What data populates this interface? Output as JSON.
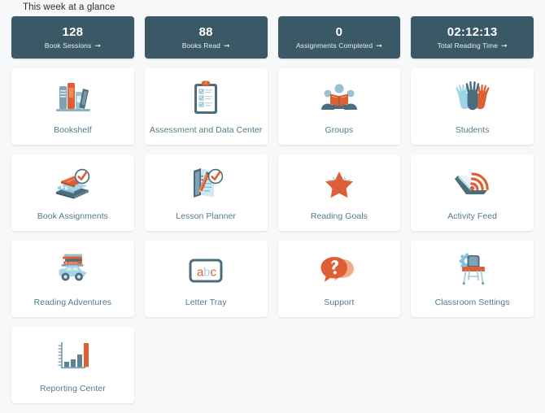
{
  "header": {
    "title": "This week at a glance"
  },
  "colors": {
    "page_background": "#f7f8f9",
    "stat_card_background": "#3a5866",
    "tile_background": "#ffffff",
    "tile_label": "#537a8c",
    "accent_orange": "#dd5f35",
    "accent_slate": "#4c6d7d",
    "accent_light_blue": "#a6d4e6"
  },
  "stats": [
    {
      "value": "128",
      "label": "Book Sessions",
      "arrow": "arrow-right-icon"
    },
    {
      "value": "88",
      "label": "Books Read",
      "arrow": "arrow-right-icon"
    },
    {
      "value": "0",
      "label": "Assignments Completed",
      "arrow": "arrow-right-icon"
    },
    {
      "value": "02:12:13",
      "label": "Total Reading Time",
      "arrow": "arrow-right-icon"
    }
  ],
  "tiles": [
    {
      "label": "Bookshelf",
      "icon": "bookshelf-icon"
    },
    {
      "label": "Assessment and Data Center",
      "icon": "clipboard-checklist-icon"
    },
    {
      "label": "Groups",
      "icon": "group-reading-icon"
    },
    {
      "label": "Students",
      "icon": "raised-hands-icon"
    },
    {
      "label": "Book Assignments",
      "icon": "books-check-icon"
    },
    {
      "label": "Lesson Planner",
      "icon": "notebook-pencil-check-icon"
    },
    {
      "label": "Reading Goals",
      "icon": "star-icon"
    },
    {
      "label": "Activity Feed",
      "icon": "book-rss-icon"
    },
    {
      "label": "Reading Adventures",
      "icon": "car-books-icon"
    },
    {
      "label": "Letter Tray",
      "icon": "abc-frame-icon"
    },
    {
      "label": "Support",
      "icon": "question-speech-bubble-icon"
    },
    {
      "label": "Classroom Settings",
      "icon": "desk-gear-icon"
    },
    {
      "label": "Reporting Center",
      "icon": "bar-chart-icon"
    }
  ],
  "letter_tray_glyphs": {
    "a": "a",
    "b": "b",
    "c": "c"
  },
  "support_glyph": "?"
}
